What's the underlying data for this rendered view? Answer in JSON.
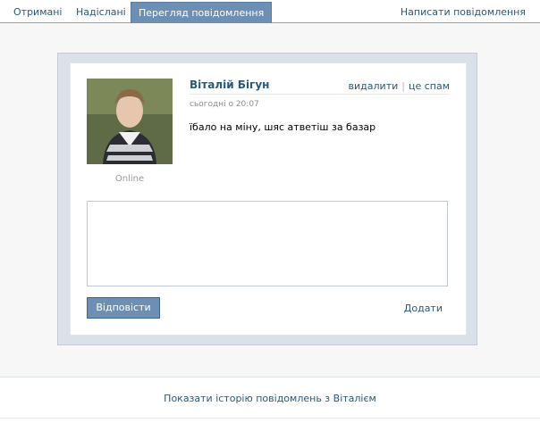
{
  "tabs": {
    "received": "Отримані",
    "sent": "Надіслані",
    "view": "Перегляд повідомлення",
    "write": "Написати повідомлення"
  },
  "message": {
    "sender": "Віталій Бігун",
    "timestamp": "сьогодні о 20:07",
    "text": "їбало на міну, шяс атветіш за базар",
    "status": "Online",
    "actions": {
      "delete": "видалити",
      "spam": "це спам",
      "separator": "|"
    }
  },
  "reply": {
    "button": "Відповісти",
    "add": "Додати",
    "value": ""
  },
  "footer": {
    "history": "Показати історію повідомлень з Віталієм"
  },
  "colors": {
    "accent": "#6d8fb3",
    "link": "#2b587a",
    "panel": "#dae1e8"
  }
}
